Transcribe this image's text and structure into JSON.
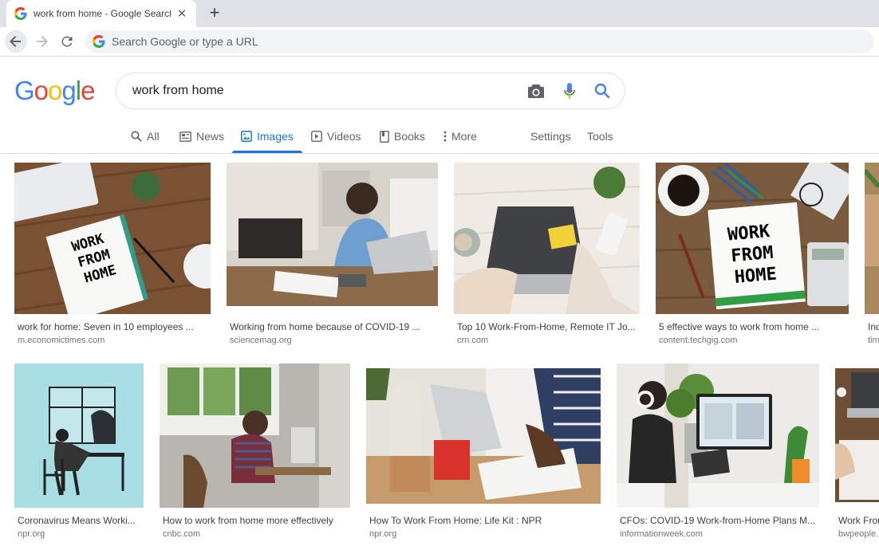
{
  "browser": {
    "tab_title": "work from home - Google Search",
    "newtab_label": "+",
    "close_label": "✕",
    "omnibox_placeholder": "Search Google or type a URL"
  },
  "google": {
    "logo_letters": [
      "G",
      "o",
      "o",
      "g",
      "l",
      "e"
    ],
    "logo_colors": [
      "#4285f4",
      "#ea4335",
      "#fbbc05",
      "#4285f4",
      "#34a853",
      "#ea4335"
    ],
    "query": "work from home"
  },
  "nav_tabs": [
    {
      "label": "All",
      "icon": "search-icon"
    },
    {
      "label": "News",
      "icon": "news-icon"
    },
    {
      "label": "Images",
      "icon": "image-icon",
      "active": true
    },
    {
      "label": "Videos",
      "icon": "video-icon"
    },
    {
      "label": "Books",
      "icon": "book-icon"
    },
    {
      "label": "More",
      "icon": "more-dots-icon"
    },
    {
      "label": "Settings"
    },
    {
      "label": "Tools"
    }
  ],
  "results": [
    {
      "caption": "work for home: Seven in 10 employees ...",
      "source": "m.economictimes.com",
      "thumb_text": [
        "WORK",
        "FROM",
        "HOME"
      ]
    },
    {
      "caption": "Working from home because of COVID-19 ...",
      "source": "sciencemag.org"
    },
    {
      "caption": "Top 10 Work-From-Home, Remote IT Jo...",
      "source": "crn.com"
    },
    {
      "caption": "5 effective ways to work from home ...",
      "source": "content.techgig.com",
      "thumb_text": [
        "WORK",
        "FROM",
        "HOME"
      ]
    },
    {
      "caption": "Ind",
      "source": "tim"
    },
    {
      "caption": "Coronavirus Means Worki...",
      "source": "npr.org"
    },
    {
      "caption": "How to work from home more effectively",
      "source": "cnbc.com"
    },
    {
      "caption": "How To Work From Home: Life Kit : NPR",
      "source": "npr.org"
    },
    {
      "caption": "CFOs: COVID-19 Work-from-Home Plans M...",
      "source": "informationweek.com"
    },
    {
      "caption": "Work From",
      "source": "bwpeople."
    }
  ],
  "colors": {
    "accent": "#1a73e8",
    "text_muted": "#70757a"
  }
}
